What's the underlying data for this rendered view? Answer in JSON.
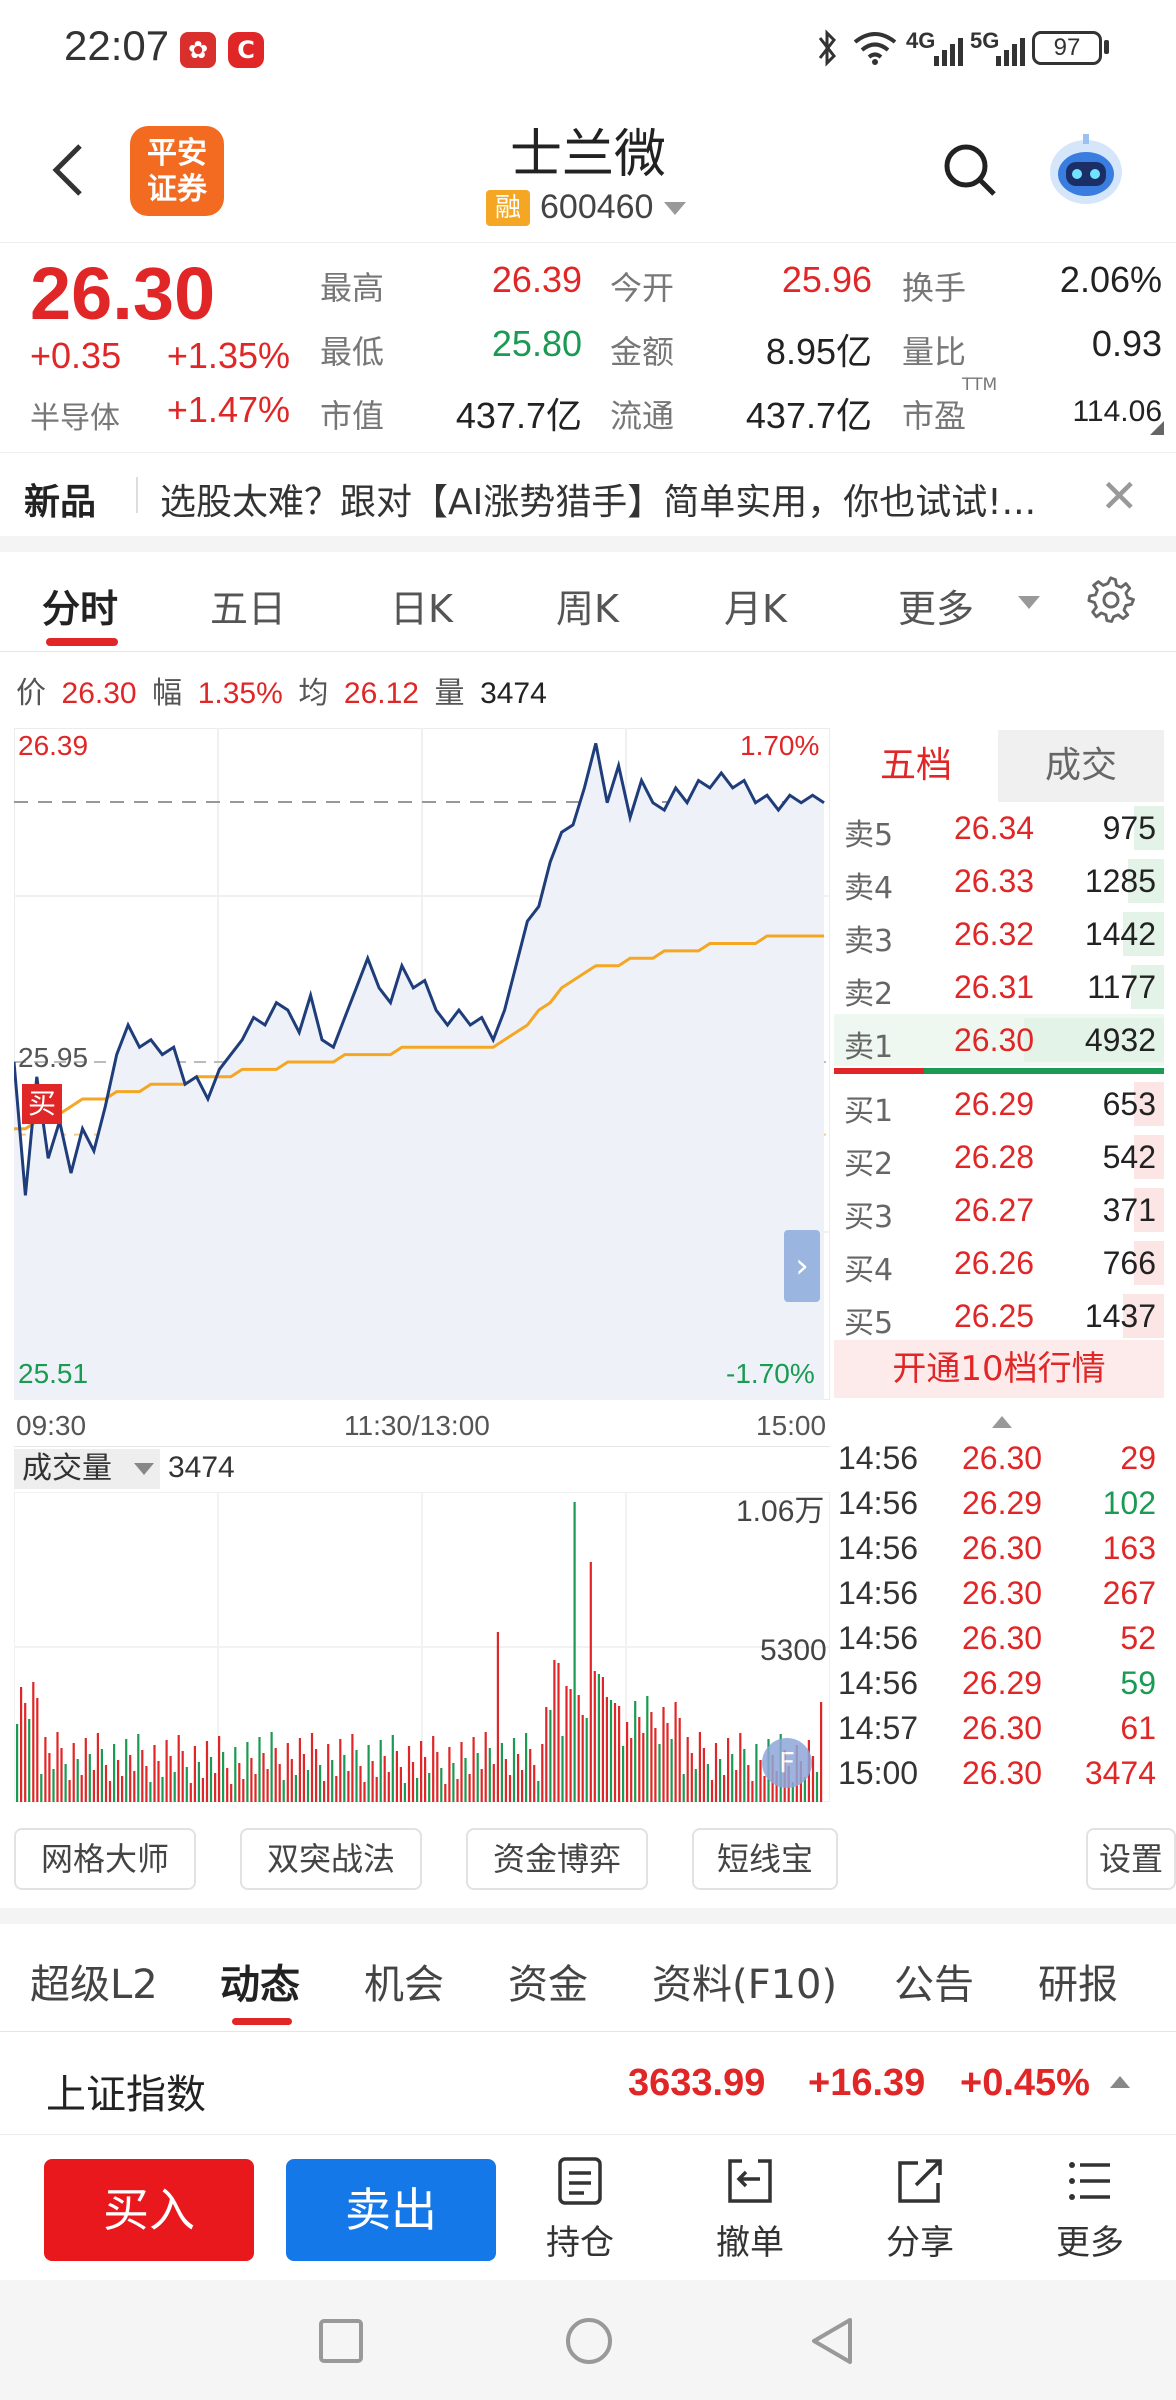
{
  "status_bar": {
    "time": "22:07",
    "battery": "97",
    "network_1": "4G",
    "network_2": "5G"
  },
  "header": {
    "broker_logo": "平安\n证券",
    "stock_name": "士兰微",
    "margin_badge": "融",
    "stock_code": "600460"
  },
  "quote": {
    "price": "26.30",
    "change": "+0.35",
    "change_pct": "+1.35%",
    "sector": "半导体",
    "sector_pct": "+1.47%",
    "high_label": "最高",
    "high": "26.39",
    "low_label": "最低",
    "low": "25.80",
    "mktcap_label": "市值",
    "mktcap": "437.7亿",
    "open_label": "今开",
    "open": "25.96",
    "amount_label": "金额",
    "amount": "8.95亿",
    "float_label": "流通",
    "float": "437.7亿",
    "turnover_label": "换手",
    "turnover": "2.06%",
    "volratio_label": "量比",
    "volratio": "0.93",
    "pe_label": "市盈",
    "pe_sup": "TTM",
    "pe": "114.06"
  },
  "news": {
    "tag": "新品",
    "text": "选股太难？跟对【AI涨势猎手】简单实用，你也试试!..."
  },
  "chart_tabs": [
    "分时",
    "五日",
    "日K",
    "周K",
    "月K",
    "更多"
  ],
  "info_line": {
    "price_label": "价",
    "price": "26.30",
    "amp_label": "幅",
    "amp": "1.35%",
    "avg_label": "均",
    "avg": "26.12",
    "vol_label": "量",
    "vol": "3474"
  },
  "chart_data": {
    "type": "line",
    "title": "",
    "x_labels": [
      "09:30",
      "11:30/13:00",
      "15:00"
    ],
    "y_left_labels": {
      "top": "26.39",
      "mid": "25.95",
      "bottom": "25.51"
    },
    "y_right_labels": {
      "top": "1.70%",
      "bottom": "-1.70%"
    },
    "ylim": [
      25.51,
      26.39
    ],
    "prev_close": 25.95,
    "series": [
      {
        "name": "价",
        "color": "#1f3d7a",
        "values": [
          25.95,
          25.77,
          25.93,
          25.82,
          25.87,
          25.8,
          25.86,
          25.83,
          25.89,
          25.96,
          26.0,
          25.97,
          25.98,
          25.96,
          25.97,
          25.92,
          25.93,
          25.9,
          25.94,
          25.96,
          25.98,
          26.01,
          26.0,
          26.03,
          26.02,
          25.99,
          26.04,
          25.98,
          25.97,
          26.01,
          26.05,
          26.09,
          26.05,
          26.03,
          26.08,
          26.05,
          26.06,
          26.02,
          26.0,
          26.02,
          26.0,
          26.01,
          25.98,
          26.02,
          26.08,
          26.14,
          26.16,
          26.22,
          26.26,
          26.27,
          26.32,
          26.38,
          26.3,
          26.35,
          26.28,
          26.33,
          26.3,
          26.29,
          26.32,
          26.3,
          26.33,
          26.32,
          26.34,
          26.32,
          26.33,
          26.3,
          26.31,
          26.29,
          26.31,
          26.3,
          26.31,
          26.3
        ]
      },
      {
        "name": "均",
        "color": "#f5a623",
        "values": [
          25.86,
          25.86,
          25.87,
          25.87,
          25.88,
          25.89,
          25.9,
          25.9,
          25.9,
          25.91,
          25.91,
          25.91,
          25.92,
          25.92,
          25.92,
          25.92,
          25.93,
          25.93,
          25.93,
          25.93,
          25.94,
          25.94,
          25.94,
          25.94,
          25.95,
          25.95,
          25.95,
          25.95,
          25.95,
          25.96,
          25.96,
          25.96,
          25.96,
          25.96,
          25.97,
          25.97,
          25.97,
          25.97,
          25.97,
          25.97,
          25.97,
          25.97,
          25.97,
          25.98,
          25.99,
          26.0,
          26.02,
          26.03,
          26.05,
          26.06,
          26.07,
          26.08,
          26.08,
          26.08,
          26.09,
          26.09,
          26.09,
          26.1,
          26.1,
          26.1,
          26.1,
          26.11,
          26.11,
          26.11,
          26.11,
          26.11,
          26.12,
          26.12,
          26.12,
          26.12,
          26.12,
          26.12
        ]
      }
    ]
  },
  "volume_chart": {
    "selector": "成交量",
    "value": "3474",
    "max_label": "1.06万",
    "mid_label": "5300",
    "ylim": [
      0,
      10600
    ]
  },
  "order_book": {
    "tabs": [
      "五档",
      "成交"
    ],
    "asks": [
      {
        "label": "卖5",
        "price": "26.34",
        "vol": "975"
      },
      {
        "label": "卖4",
        "price": "26.33",
        "vol": "1285"
      },
      {
        "label": "卖3",
        "price": "26.32",
        "vol": "1442"
      },
      {
        "label": "卖2",
        "price": "26.31",
        "vol": "1177"
      },
      {
        "label": "卖1",
        "price": "26.30",
        "vol": "4932"
      }
    ],
    "bids": [
      {
        "label": "买1",
        "price": "26.29",
        "vol": "653"
      },
      {
        "label": "买2",
        "price": "26.28",
        "vol": "542"
      },
      {
        "label": "买3",
        "price": "26.27",
        "vol": "371"
      },
      {
        "label": "买4",
        "price": "26.26",
        "vol": "766"
      },
      {
        "label": "买5",
        "price": "26.25",
        "vol": "1437"
      }
    ],
    "open_l10": "开通10档行情"
  },
  "trades": [
    {
      "time": "14:56",
      "price": "26.30",
      "vol": "29",
      "dir": "up"
    },
    {
      "time": "14:56",
      "price": "26.29",
      "vol": "102",
      "dir": "down"
    },
    {
      "time": "14:56",
      "price": "26.30",
      "vol": "163",
      "dir": "up"
    },
    {
      "time": "14:56",
      "price": "26.30",
      "vol": "267",
      "dir": "up"
    },
    {
      "time": "14:56",
      "price": "26.30",
      "vol": "52",
      "dir": "up"
    },
    {
      "time": "14:56",
      "price": "26.29",
      "vol": "59",
      "dir": "down"
    },
    {
      "time": "14:57",
      "price": "26.30",
      "vol": "61",
      "dir": "up"
    },
    {
      "time": "15:00",
      "price": "26.30",
      "vol": "3474",
      "dir": "up"
    }
  ],
  "tools": [
    "网格大师",
    "双突战法",
    "资金博弈",
    "短线宝",
    "设置"
  ],
  "buy_marker": "买",
  "info_tabs": [
    "超级L2",
    "动态",
    "机会",
    "资金",
    "资料(F10)",
    "公告",
    "研报"
  ],
  "index": {
    "name": "上证指数",
    "value": "3633.99",
    "change": "+16.39",
    "pct": "+0.45%"
  },
  "actions": {
    "buy": "买入",
    "sell": "卖出",
    "holdings": "持仓",
    "cancel": "撤单",
    "share": "分享",
    "more": "更多"
  },
  "colors": {
    "up": "#e02626",
    "down": "#1a9a52",
    "price_line": "#1f3d7a",
    "avg_line": "#f5a623"
  }
}
